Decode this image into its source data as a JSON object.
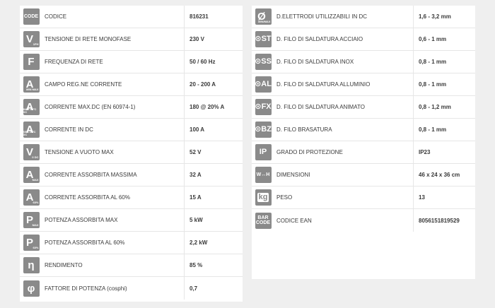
{
  "left_specs": [
    {
      "icon": "code-icon",
      "icon_text": "CODE",
      "label": "CODICE",
      "value": "816231"
    },
    {
      "icon": "voltage-1ph-icon",
      "icon_text": "V",
      "icon_sub": "1PH",
      "label": "TENSIONE DI RETE MONOFASE",
      "value": "230 V"
    },
    {
      "icon": "frequency-icon",
      "icon_text": "F",
      "label": "FREQUENZA DI RETE",
      "value": "50 / 60 Hz"
    },
    {
      "icon": "current-range-icon",
      "icon_text": "A",
      "icon_sub": "MIN MAX",
      "label": "CAMPO REG.NE CORRENTE",
      "value": "20 - 200 A"
    },
    {
      "icon": "current-max-dc-icon",
      "icon_text": "A",
      "icon_sub": "MAX 40°C DC",
      "label": "CORRENTE MAX.DC (EN 60974-1)",
      "value": "180 @ 20% A"
    },
    {
      "icon": "current-dc-icon",
      "icon_text": "A",
      "icon_sub": "60% 40°C DC",
      "label": "CORRENTE IN DC",
      "value": "100 A"
    },
    {
      "icon": "open-voltage-icon",
      "icon_text": "V",
      "icon_sub": "0 DC",
      "label": "TENSIONE A VUOTO MAX",
      "value": "52 V"
    },
    {
      "icon": "current-absorbed-max-icon",
      "icon_text": "A",
      "icon_sub": "MAX",
      "label": "CORRENTE ASSORBITA MASSIMA",
      "value": "32 A"
    },
    {
      "icon": "current-absorbed-60-icon",
      "icon_text": "A",
      "icon_sub": "60%",
      "label": "CORRENTE ASSORBITA AL 60%",
      "value": "15 A"
    },
    {
      "icon": "power-max-icon",
      "icon_text": "P",
      "icon_sub": "MAX",
      "label": "POTENZA ASSORBITA MAX",
      "value": "5 kW"
    },
    {
      "icon": "power-60-icon",
      "icon_text": "P",
      "icon_sub": "60%",
      "label": "POTENZA ASSORBITA AL 60%",
      "value": "2,2 kW"
    },
    {
      "icon": "efficiency-icon",
      "icon_text": "η",
      "label": "RENDIMENTO",
      "value": "85 %"
    },
    {
      "icon": "power-factor-icon",
      "icon_text": "φ",
      "label": "FATTORE DI POTENZA (cosphi)",
      "value": "0,7"
    }
  ],
  "right_specs": [
    {
      "icon": "electrode-diameter-icon",
      "icon_text": "Ø",
      "icon_sub": "MIN/MAX",
      "label": "D.ELETTRODI UTILIZZABILI IN DC",
      "value": "1,6 - 3,2 mm"
    },
    {
      "icon": "steel-wire-icon",
      "icon_text": "ST",
      "label": "D. FILO DI SALDATURA ACCIAIO",
      "value": "0,6 - 1 mm"
    },
    {
      "icon": "stainless-wire-icon",
      "icon_text": "SS",
      "label": "D. FILO DI SALDATURA INOX",
      "value": "0,8 - 1 mm"
    },
    {
      "icon": "aluminium-wire-icon",
      "icon_text": "AL",
      "label": "D. FILO DI SALDATURA ALLUMINIO",
      "value": "0,8 - 1 mm"
    },
    {
      "icon": "flux-wire-icon",
      "icon_text": "FX",
      "label": "D. FILO DI SALDATURA ANIMATO",
      "value": "0,8 - 1,2 mm"
    },
    {
      "icon": "brazing-wire-icon",
      "icon_text": "BZ",
      "label": "D. FILO BRASATURA",
      "value": "0,8 - 1 mm"
    },
    {
      "icon": "protection-grade-icon",
      "icon_text": "IP",
      "label": "GRADO DI PROTEZIONE",
      "value": "IP23"
    },
    {
      "icon": "dimensions-icon",
      "icon_text": "WHL",
      "label": "DIMENSIONI",
      "value": "46 x 24 x 36 cm"
    },
    {
      "icon": "weight-icon",
      "icon_text": "kg",
      "label": "PESO",
      "value": "13"
    },
    {
      "icon": "barcode-icon",
      "icon_text": "BAR CODE",
      "label": "CODICE EAN",
      "value": "8056151819529"
    }
  ]
}
